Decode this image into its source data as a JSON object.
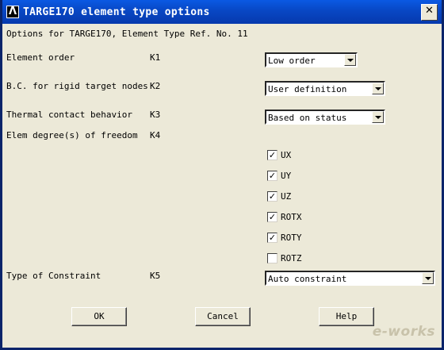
{
  "window": {
    "title": "TARGE170 element type options",
    "app_icon_glyph": "Λ",
    "close_glyph": "✕"
  },
  "header": "Options for TARGE170, Element Type Ref. No. 11",
  "rows": [
    {
      "label": "Element order",
      "key": "K1",
      "value": "Low order"
    },
    {
      "label": "B.C. for rigid target nodes",
      "key": "K2",
      "value": "User definition"
    },
    {
      "label": "Thermal contact behavior",
      "key": "K3",
      "value": "Based on status"
    },
    {
      "label": "Elem degree(s) of freedom",
      "key": "K4"
    },
    {
      "label": "Type of Constraint",
      "key": "K5",
      "value": "Auto constraint"
    }
  ],
  "dof": [
    {
      "label": "UX",
      "checked": true
    },
    {
      "label": "UY",
      "checked": true
    },
    {
      "label": "UZ",
      "checked": true
    },
    {
      "label": "ROTX",
      "checked": true
    },
    {
      "label": "ROTY",
      "checked": true
    },
    {
      "label": "ROTZ",
      "checked": false
    }
  ],
  "buttons": {
    "ok": "OK",
    "cancel": "Cancel",
    "help": "Help"
  },
  "watermark": "e-works"
}
